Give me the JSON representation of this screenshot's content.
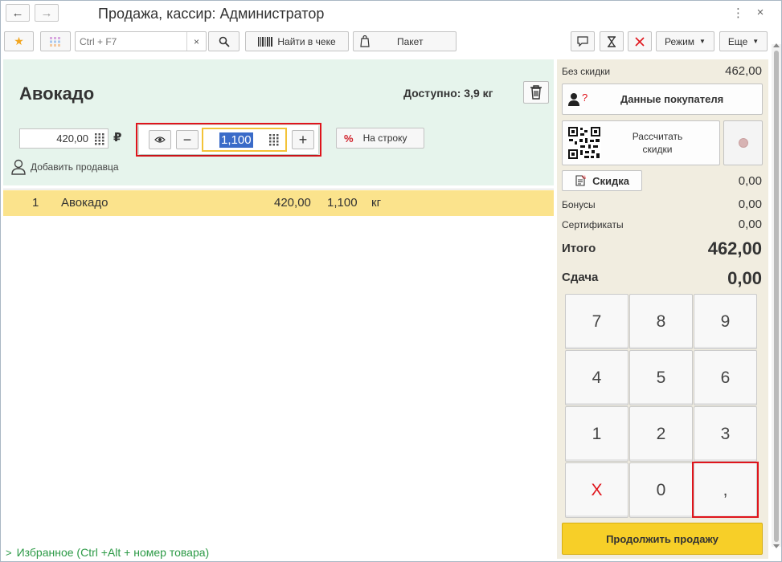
{
  "window": {
    "title": "Продажа, кассир: Администратор",
    "back_icon": "←",
    "forward_icon": "→",
    "menu_icon": "⋮",
    "close_icon": "×"
  },
  "toolbar": {
    "search_placeholder": "Ctrl + F7",
    "find_in_receipt_label": "Найти в чеке",
    "package_label": "Пакет",
    "mode_label": "Режим",
    "more_label": "Еще"
  },
  "product": {
    "name": "Авокадо",
    "available": "Доступно: 3,9 кг",
    "price": "420,00",
    "currency": "₽",
    "quantity": "1,100",
    "to_row_label": "На строку",
    "add_seller_label": "Добавить продавца"
  },
  "receipt": {
    "rows": [
      {
        "num": "1",
        "name": "Авокадо",
        "price": "420,00",
        "qty": "1,100",
        "unit": "кг"
      }
    ]
  },
  "summary": {
    "no_discount_label": "Без скидки",
    "no_discount_value": "462,00",
    "customer_data_label": "Данные покупателя",
    "calc_discounts_label": "Рассчитать скидки",
    "discount_label": "Скидка",
    "discount_value": "0,00",
    "bonuses_label": "Бонусы",
    "bonuses_value": "0,00",
    "certificates_label": "Сертификаты",
    "certificates_value": "0,00",
    "total_label": "Итого",
    "total_value": "462,00",
    "change_label": "Сдача",
    "change_value": "0,00",
    "continue_label": "Продолжить продажу"
  },
  "keypad": {
    "k7": "7",
    "k8": "8",
    "k9": "9",
    "k4": "4",
    "k5": "5",
    "k6": "6",
    "k1": "1",
    "k2": "2",
    "k3": "3",
    "kx": "X",
    "k0": "0",
    "kcomma": ","
  },
  "footer": {
    "favorites_label": "Избранное (Ctrl +Alt + номер товара)"
  },
  "colors": {
    "accent_green": "#e6f4ec",
    "row_highlight": "#fbe38c",
    "continue_button": "#f7cf28",
    "highlight_frame": "#e0151c",
    "right_panel": "#f1ede0"
  }
}
